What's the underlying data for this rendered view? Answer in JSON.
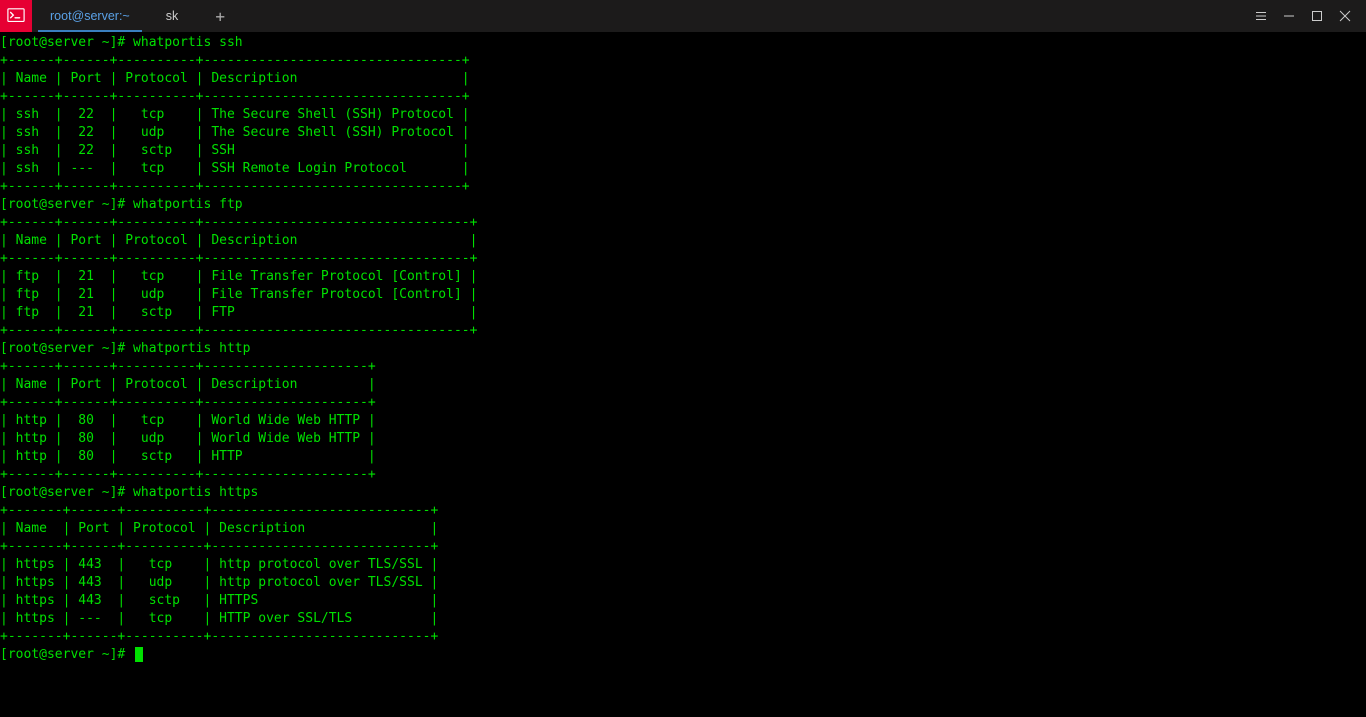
{
  "window": {
    "tabs": [
      {
        "label": "root@server:~",
        "active": true
      },
      {
        "label": "sk",
        "active": false
      }
    ]
  },
  "colors": {
    "termGreen": "#00e000",
    "titlebar": "#1c1b1b",
    "accent": "#3a7fbf",
    "appIconBg": "#e60033"
  },
  "prompt": {
    "user": "root",
    "host": "server",
    "cwd": "~",
    "symbol": "#"
  },
  "commands": [
    {
      "cmdline": "whatportis ssh",
      "columns": [
        "Name",
        "Port",
        "Protocol",
        "Description"
      ],
      "rows": [
        {
          "name": "ssh",
          "port": "22",
          "protocol": "tcp",
          "description": "The Secure Shell (SSH) Protocol"
        },
        {
          "name": "ssh",
          "port": "22",
          "protocol": "udp",
          "description": "The Secure Shell (SSH) Protocol"
        },
        {
          "name": "ssh",
          "port": "22",
          "protocol": "sctp",
          "description": "SSH"
        },
        {
          "name": "ssh",
          "port": "---",
          "protocol": "tcp",
          "description": "SSH Remote Login Protocol"
        }
      ]
    },
    {
      "cmdline": "whatportis ftp",
      "columns": [
        "Name",
        "Port",
        "Protocol",
        "Description"
      ],
      "rows": [
        {
          "name": "ftp",
          "port": "21",
          "protocol": "tcp",
          "description": "File Transfer Protocol [Control]"
        },
        {
          "name": "ftp",
          "port": "21",
          "protocol": "udp",
          "description": "File Transfer Protocol [Control]"
        },
        {
          "name": "ftp",
          "port": "21",
          "protocol": "sctp",
          "description": "FTP"
        }
      ]
    },
    {
      "cmdline": "whatportis http",
      "columns": [
        "Name",
        "Port",
        "Protocol",
        "Description"
      ],
      "rows": [
        {
          "name": "http",
          "port": "80",
          "protocol": "tcp",
          "description": "World Wide Web HTTP"
        },
        {
          "name": "http",
          "port": "80",
          "protocol": "udp",
          "description": "World Wide Web HTTP"
        },
        {
          "name": "http",
          "port": "80",
          "protocol": "sctp",
          "description": "HTTP"
        }
      ]
    },
    {
      "cmdline": "whatportis https",
      "columns": [
        "Name",
        "Port",
        "Protocol",
        "Description"
      ],
      "rows": [
        {
          "name": "https",
          "port": "443",
          "protocol": "tcp",
          "description": "http protocol over TLS/SSL"
        },
        {
          "name": "https",
          "port": "443",
          "protocol": "udp",
          "description": "http protocol over TLS/SSL"
        },
        {
          "name": "https",
          "port": "443",
          "protocol": "sctp",
          "description": "HTTPS"
        },
        {
          "name": "https",
          "port": "---",
          "protocol": "tcp",
          "description": "HTTP over SSL/TLS"
        }
      ]
    }
  ]
}
